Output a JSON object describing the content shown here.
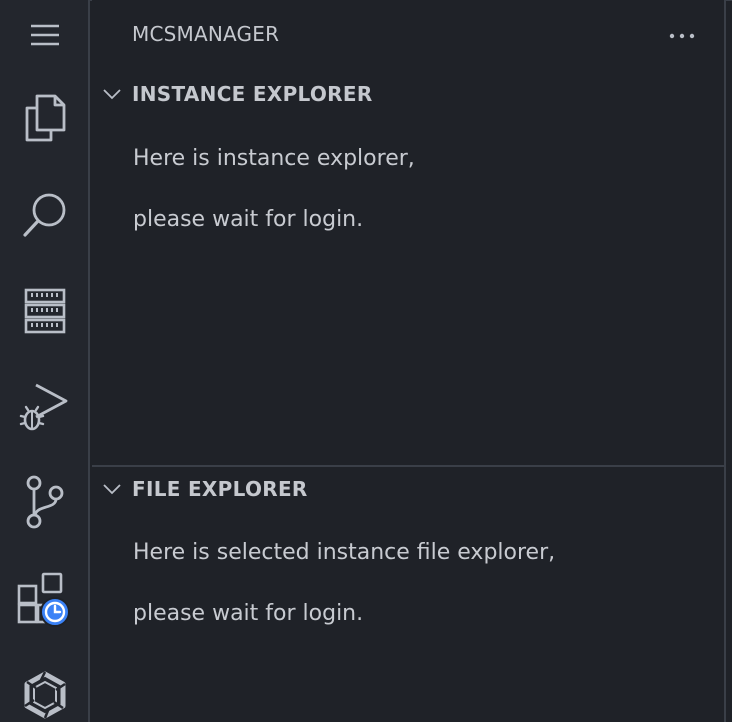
{
  "sidebar": {
    "title": "MCSMANAGER",
    "more_label": "···"
  },
  "activity_bar": {
    "items": [
      {
        "icon": "hamburger-menu-icon"
      },
      {
        "icon": "files-explorer-icon"
      },
      {
        "icon": "search-icon"
      },
      {
        "icon": "mcsmanager-server-icon"
      },
      {
        "icon": "run-debug-icon"
      },
      {
        "icon": "source-control-icon"
      },
      {
        "icon": "extensions-clock-icon"
      },
      {
        "icon": "hexagon-logo-icon"
      }
    ]
  },
  "sections": {
    "instance_explorer": {
      "title": "INSTANCE EXPLORER",
      "line1": "Here is instance explorer,",
      "line2": "please wait for login."
    },
    "file_explorer": {
      "title": "FILE EXPLORER",
      "line1": "Here is selected instance file explorer,",
      "line2": "please wait for login."
    }
  },
  "colors": {
    "background": "#1f2228",
    "activity_bar": "#23262d",
    "icon": "#b9bec7",
    "text": "#c8cbd1",
    "accent": "#3b82f6"
  }
}
